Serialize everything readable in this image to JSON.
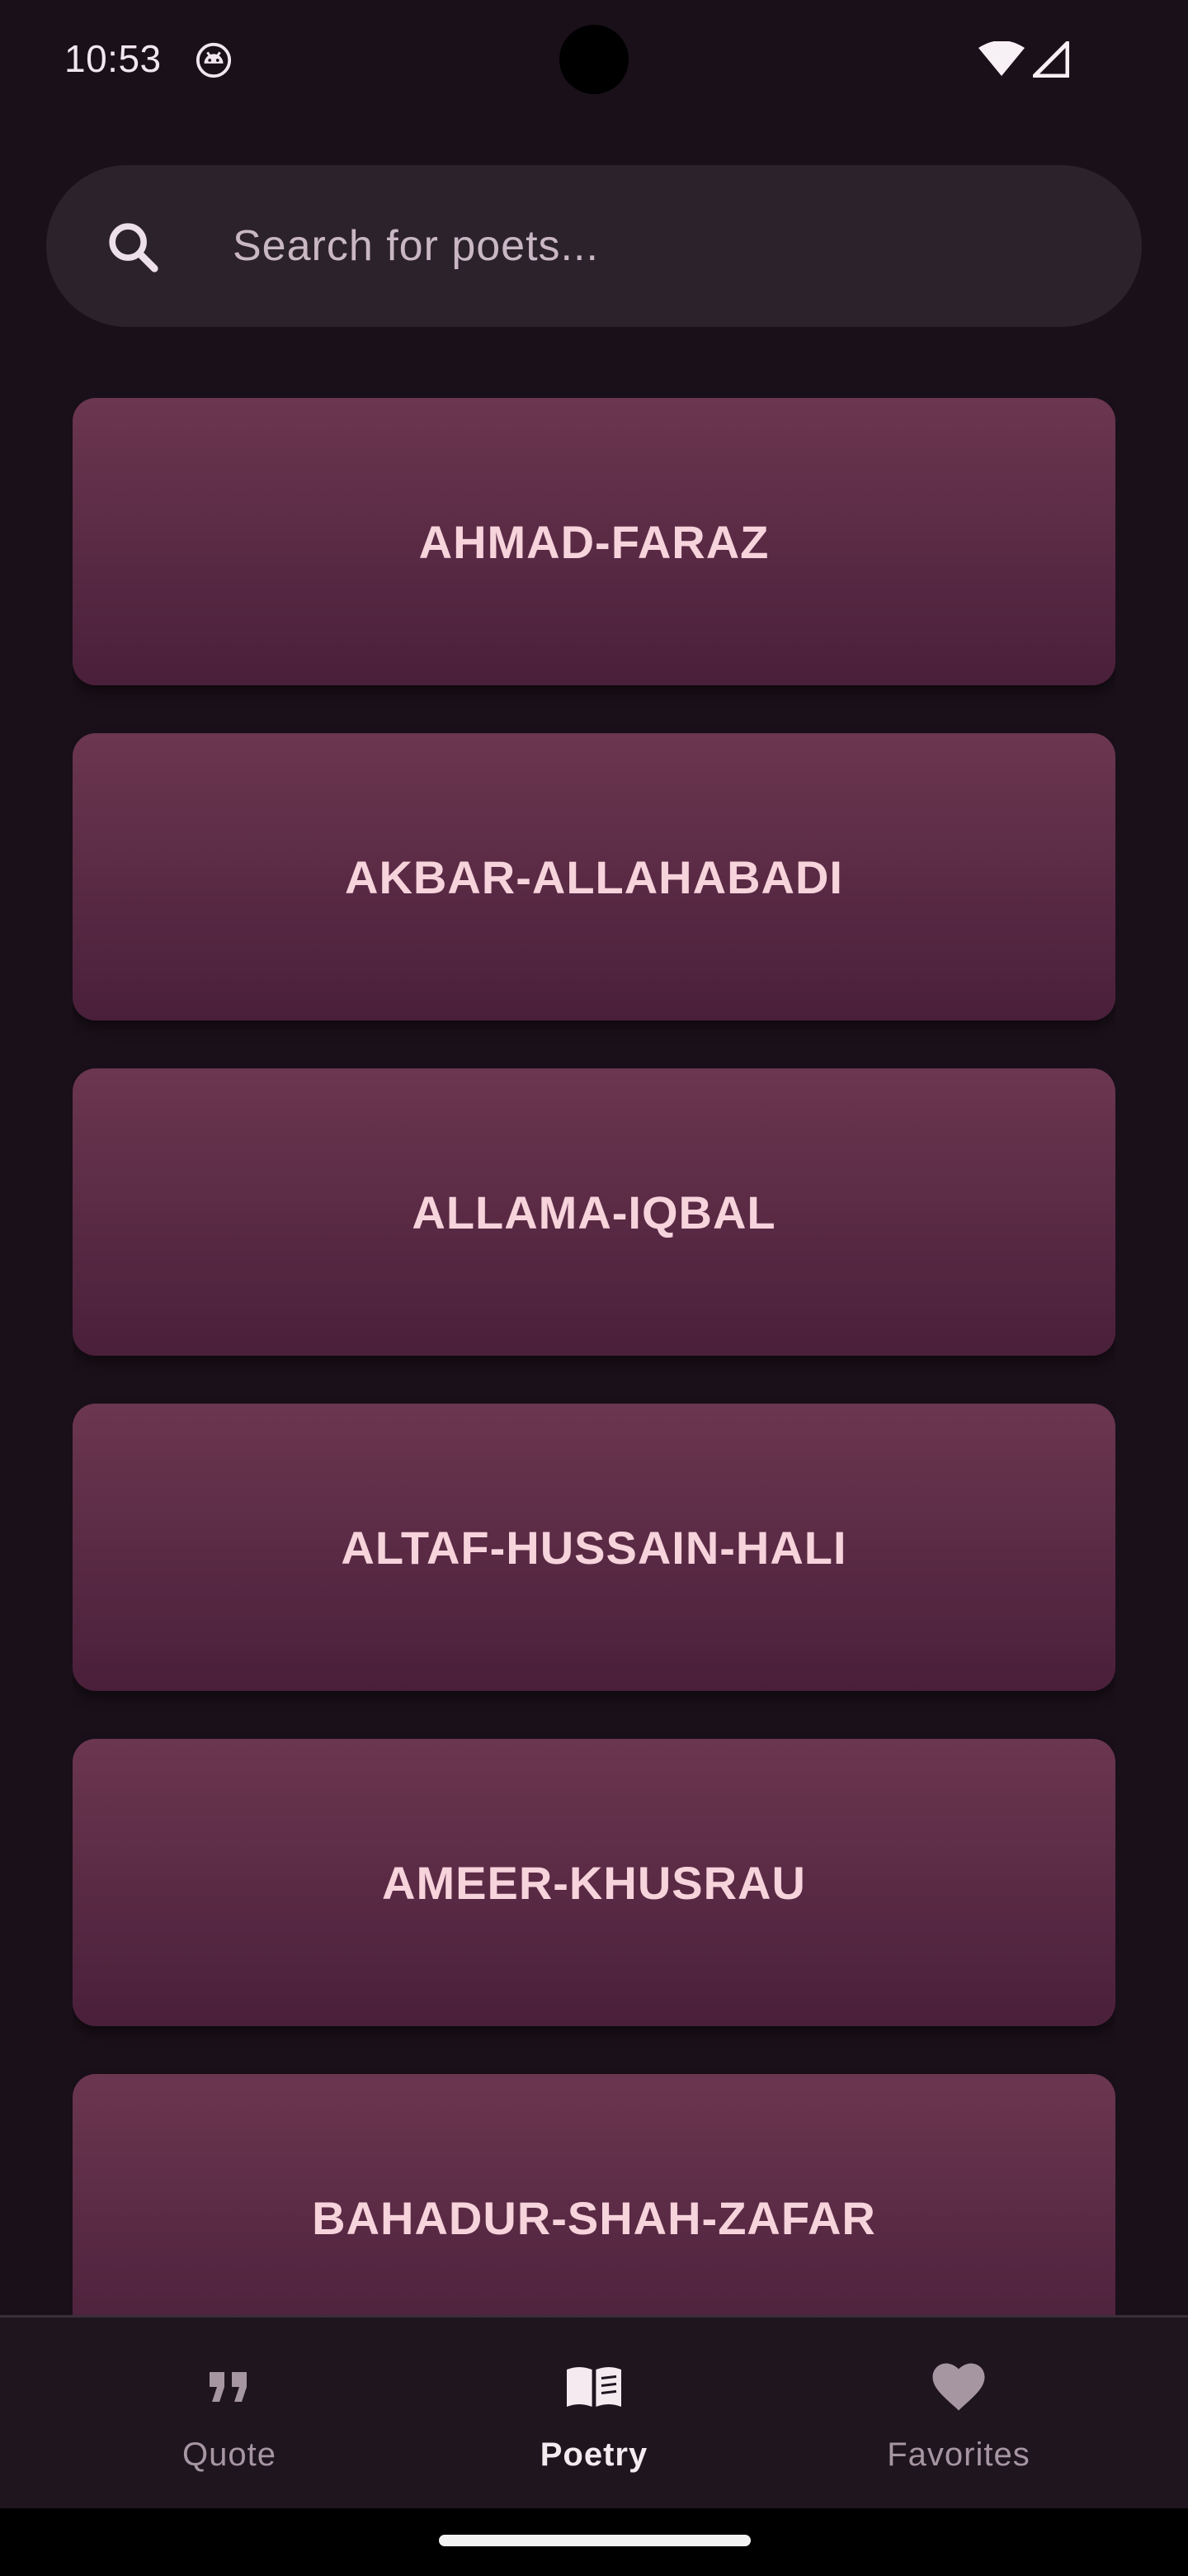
{
  "status_bar": {
    "time": "10:53",
    "app_icon": "android-debug-icon",
    "wifi_icon": "wifi-icon",
    "signal_icon": "cell-signal-icon"
  },
  "search": {
    "placeholder": "Search for poets...",
    "value": "",
    "icon": "search-icon"
  },
  "poets": [
    {
      "label": "AHMAD-FARAZ"
    },
    {
      "label": "AKBAR-ALLAHABADI"
    },
    {
      "label": "ALLAMA-IQBAL"
    },
    {
      "label": "ALTAF-HUSSAIN-HALI"
    },
    {
      "label": "AMEER-KHUSRAU"
    },
    {
      "label": "BAHADUR-SHAH-ZAFAR"
    }
  ],
  "bottom_nav": {
    "items": [
      {
        "label": "Quote",
        "icon": "quote-icon",
        "active": false
      },
      {
        "label": "Poetry",
        "icon": "open-book-icon",
        "active": true
      },
      {
        "label": "Favorites",
        "icon": "heart-icon",
        "active": false
      }
    ]
  },
  "colors": {
    "background": "#1a1019",
    "card_top": "#6b3650",
    "card_bottom": "#4a1f3a",
    "card_text": "#f7d3dc",
    "search_bg": "#2c222c",
    "nav_bg": "#1f151f"
  }
}
